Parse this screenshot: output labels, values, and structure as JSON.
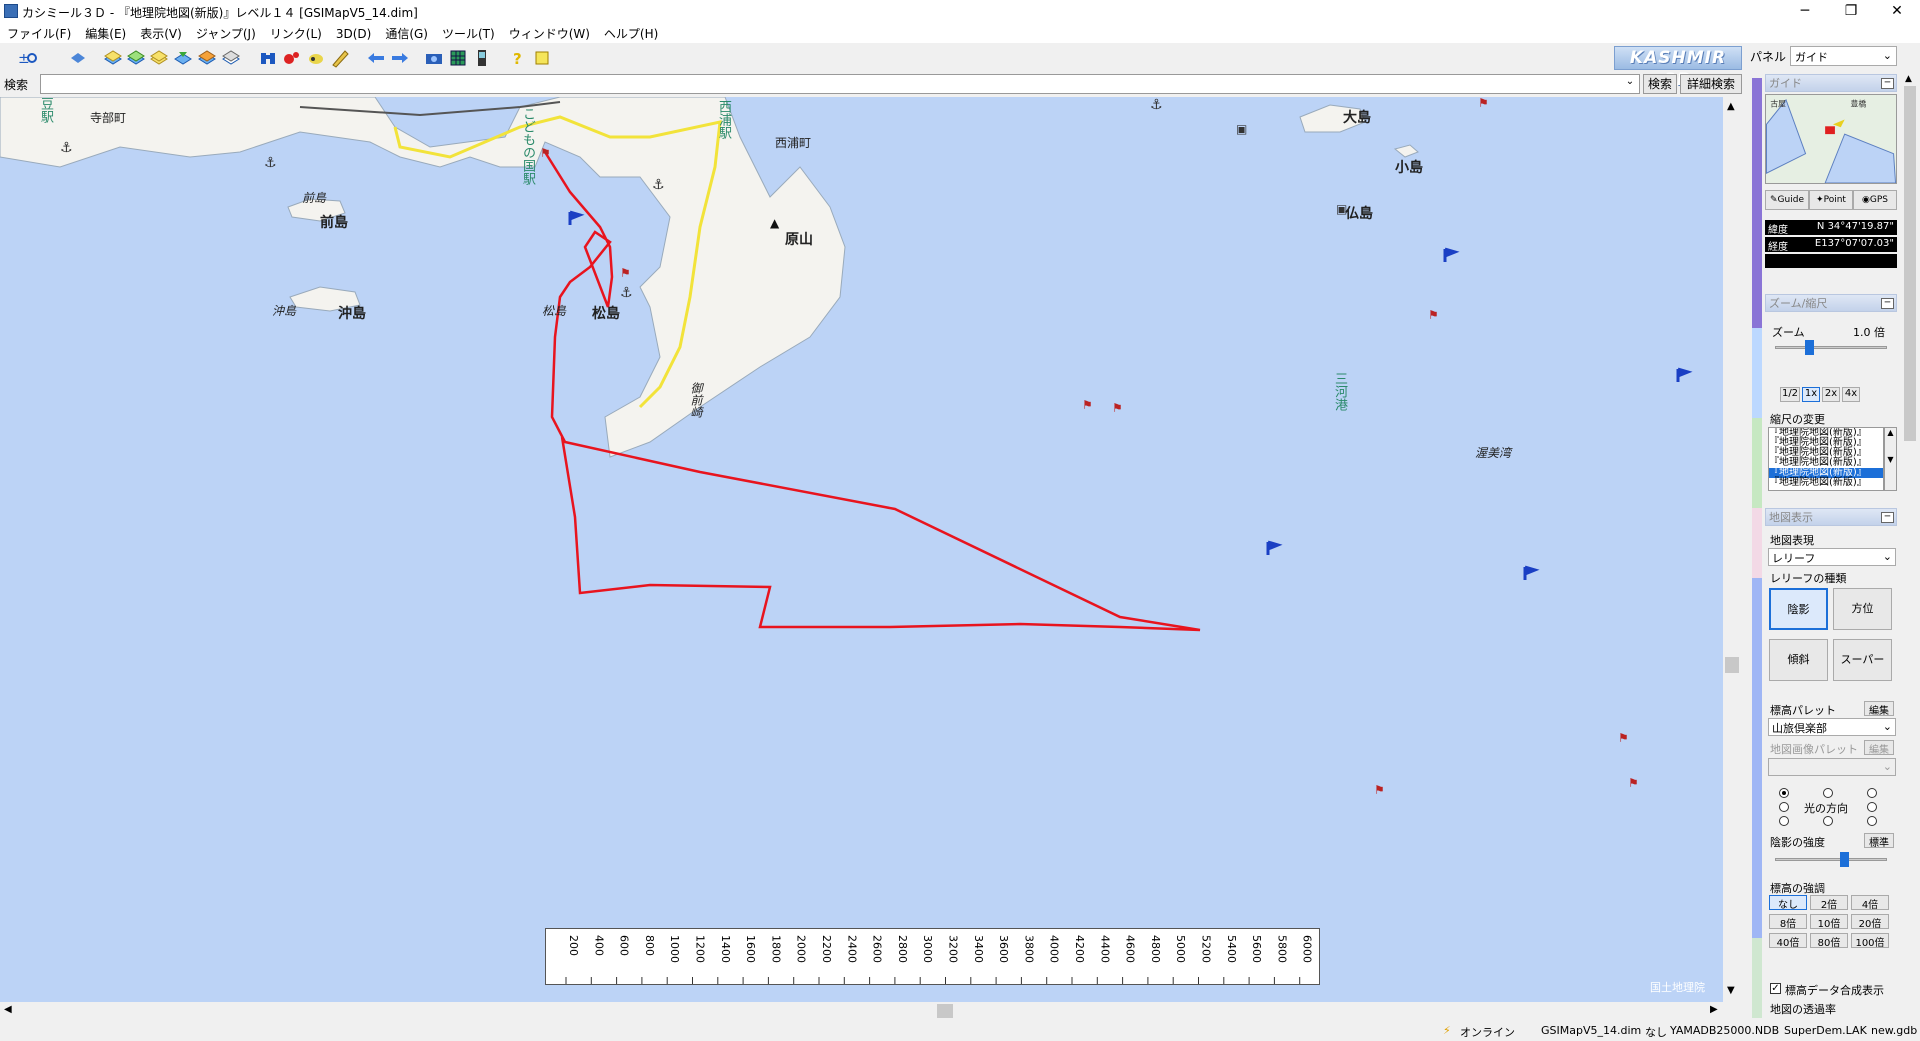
{
  "window": {
    "title": "カシミール３Ｄ - 『地理院地図(新版)』レベル１４ [GSIMapV5_14.dim]",
    "minimize": "─",
    "maximize": "❐",
    "close": "✕"
  },
  "menu": [
    "ファイル(F)",
    "編集(E)",
    "表示(V)",
    "ジャンプ(J)",
    "リンク(L)",
    "3D(D)",
    "通信(G)",
    "ツール(T)",
    "ウィンドウ(W)",
    "ヘルプ(H)"
  ],
  "logo": "KASHMIR 3D",
  "panel_selector": {
    "label": "パネル",
    "value": "ガイド"
  },
  "search": {
    "label": "検索",
    "value": "",
    "search_button": "検索",
    "detail_button": "詳細検索"
  },
  "map": {
    "place_labels": {
      "terabe": "寺部町",
      "nishiura": "西浦町",
      "ohshima": "大島",
      "koshima": "小島",
      "butsushima": "仏島",
      "haraya": "原山",
      "maejima_small": "前島",
      "maejima": "前島",
      "okishima_small": "沖島",
      "okishima": "沖島",
      "matsushima_small": "松島",
      "matsushima": "松島",
      "mikawa": "三河港",
      "atsumi": "渥美湾",
      "omaezaki": "御前崎"
    },
    "station_labels": {
      "kodomo": "こどもの国駅",
      "nishiura_st": "西浦駅",
      "edge_st": "豆駅"
    },
    "attribution": "国土地理院"
  },
  "ruler": {
    "ticks": [
      "200",
      "400",
      "600",
      "800",
      "1000",
      "1200",
      "1400",
      "1600",
      "1800",
      "2000",
      "2200",
      "2400",
      "2600",
      "2800",
      "3000",
      "3200",
      "3400",
      "3600",
      "3800",
      "4000",
      "4200",
      "4400",
      "4600",
      "4800",
      "5000",
      "5200",
      "5400",
      "5600",
      "5800",
      "6000"
    ]
  },
  "side_panel": {
    "guide": {
      "title": "ガイド",
      "mini_labels": {
        "left": "古屋",
        "right": "豊橋"
      },
      "tabs": [
        "Guide",
        "Point",
        "GPS"
      ],
      "lat_label": "緯度",
      "lat_value": "N 34°47'19.87\"",
      "lon_label": "経度",
      "lon_value": "E137°07'07.03\""
    },
    "zoom": {
      "title": "ズーム/縮尺",
      "zoom_label": "ズーム",
      "zoom_value": "1.0 倍",
      "zoom_level": 0.3,
      "buttons": [
        "1/2",
        "1x",
        "2x",
        "4x"
      ],
      "scale_change_label": "縮尺の変更",
      "scale_items": [
        "『地理院地図(新版)』",
        "『地理院地図(新版)』",
        "『地理院地図(新版)』",
        "『地理院地図(新版)』",
        "『地理院地図(新版)』",
        "『地理院地図(新版)』"
      ]
    },
    "display": {
      "title": "地図表示",
      "map_expr_label": "地図表現",
      "map_expr_value": "レリーフ",
      "relief_kind_label": "レリーフの種類",
      "relief_buttons": [
        "陰影",
        "方位",
        "傾斜",
        "スーパー"
      ],
      "palette_label": "標高パレット",
      "palette_edit": "編集",
      "palette_value": "山旅倶楽部",
      "image_palette_label": "地図画像パレット",
      "image_palette_edit": "編集",
      "light_dir_label": "光の方向",
      "shade_strength_label": "陰影の強度",
      "shade_strength_btn": "標準",
      "shade_level": 0.62,
      "emphasis_label": "標高の強調",
      "emphasis_buttons": [
        "なし",
        "2倍",
        "4倍",
        "8倍",
        "10倍",
        "20倍",
        "40倍",
        "80倍",
        "100倍"
      ],
      "composite_label": "標高データ合成表示",
      "transparency_label": "地図の透過率"
    }
  },
  "status": {
    "online": "オンライン",
    "items": [
      "GSIMapV5_14.dim",
      "なし",
      "YAMADB25000.NDB",
      "SuperDem.LAK",
      "new.gdb"
    ]
  },
  "colors": {
    "sea": "#bcd3f6",
    "land": "#f4f3ef",
    "track": "#e8141e",
    "road": "#f2e33a",
    "flag": "#1a3fc4"
  }
}
